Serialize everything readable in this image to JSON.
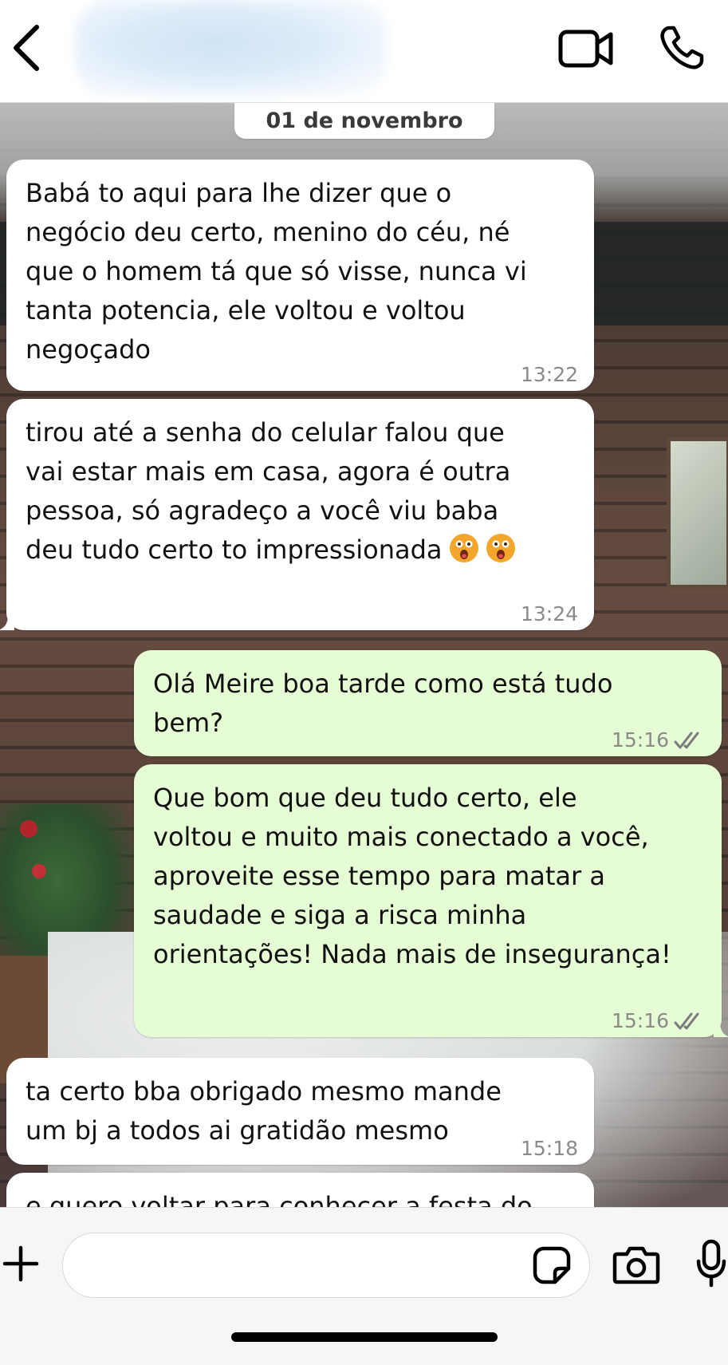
{
  "header": {
    "back_icon": "chevron-left-icon",
    "contact_name": "",
    "video_icon": "video-camera-icon",
    "call_icon": "phone-icon"
  },
  "chat": {
    "date_separator": "01 de novembro",
    "messages": [
      {
        "direction": "incoming",
        "text": "Babá to aqui para lhe dizer que o\nnegócio deu certo, menino do céu, né\nque o homem tá que só visse, nunca vi\ntanta potencia, ele voltou e voltou\nnegoçado",
        "time": "13:22"
      },
      {
        "direction": "incoming",
        "text": "tirou até a senha do celular falou que\nvai estar mais em casa, agora é outra\npessoa, só agradeço a você viu baba\ndeu tudo certo to impressionada",
        "emojis": [
          "astonished-face-emoji",
          "astonished-face-emoji"
        ],
        "time": "13:24"
      },
      {
        "direction": "outgoing",
        "text": "Olá Meire boa tarde como está tudo\nbem?",
        "time": "15:16",
        "status": "read"
      },
      {
        "direction": "outgoing",
        "text": "Que bom que deu tudo certo, ele\nvoltou e muito mais conectado a você,\naproveite esse tempo para matar a\nsaudade e siga a risca minha\norientações! Nada mais de insegurança!",
        "time": "15:16",
        "status": "read"
      },
      {
        "direction": "incoming",
        "text": "ta certo bba obrigado mesmo mande\num bj a todos ai gratidão mesmo",
        "time": "15:18"
      },
      {
        "direction": "incoming",
        "text": "e quero voltar para conhecer a festa do",
        "time": ""
      }
    ]
  },
  "composer": {
    "plus_icon": "plus-icon",
    "input_value": "",
    "sticker_icon": "sticker-icon",
    "camera_icon": "camera-icon",
    "mic_icon": "microphone-icon"
  },
  "colors": {
    "incoming_bubble": "#ffffff",
    "outgoing_bubble": "#e5fcd4",
    "timestamp": "#8a8a8a"
  }
}
